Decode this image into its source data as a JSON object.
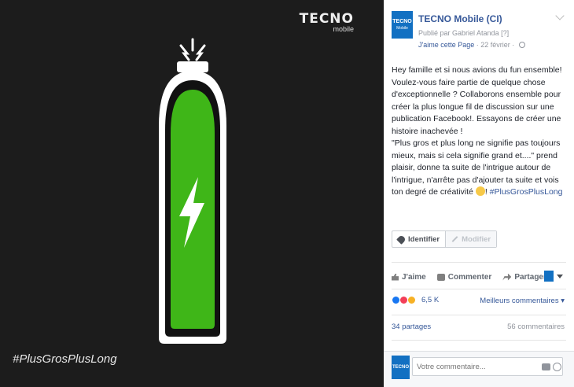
{
  "photo": {
    "brand_name": "TECNO",
    "brand_sub": "mobile",
    "hashtag": "#PlusGrosPlusLong",
    "battery_color": "#3fb618"
  },
  "post": {
    "page_name": "TECNO Mobile (CI)",
    "avatar_text": "TECNO",
    "avatar_sub": "Mobile",
    "posted_by": "Publié par Gabriel Atanda [?]",
    "like_page": "J'aime cette Page",
    "date": " · 22 février · ",
    "paragraph1": "Hey famille et si nous avions du fun ensemble! Voulez-vous faire partie de quelque chose d'exceptionnelle ? Collaborons ensemble pour créer la plus longue fil de discussion sur une publication Facebook!. Essayons de créer une histoire inachevée !",
    "paragraph2": "\"Plus gros et plus long ne signifie pas toujours mieux, mais si cela signifie grand et....\" prend plaisir, donne ta suite de l'intrigue autour de l'intrigue, n'arrête pas d'ajouter ta suite et vois ton degré de créativité ",
    "hashtag_link": "#PlusGrosPlusLong",
    "hashtag_prefix": "! "
  },
  "tag_buttons": {
    "identify": "Identifier",
    "edit": "Modifier"
  },
  "actions": {
    "like": "J'aime",
    "comment": "Commenter",
    "share": "Partager"
  },
  "reactions": {
    "count": "6,5 K",
    "top_comments": "Meilleurs commentaires ▾"
  },
  "stats": {
    "shares": "34 partages",
    "comments": "56 commentaires"
  },
  "comment_box": {
    "placeholder": "Votre commentaire...",
    "avatar_text": "TECNO"
  },
  "colors": {
    "fb_blue": "#365899",
    "brand_blue": "#1270c2"
  },
  "icons": [
    "tag-icon",
    "pencil-icon",
    "thumb-icon",
    "comment-icon",
    "share-icon",
    "globe-icon",
    "camera-icon",
    "smiley-icon",
    "lightning-icon"
  ]
}
